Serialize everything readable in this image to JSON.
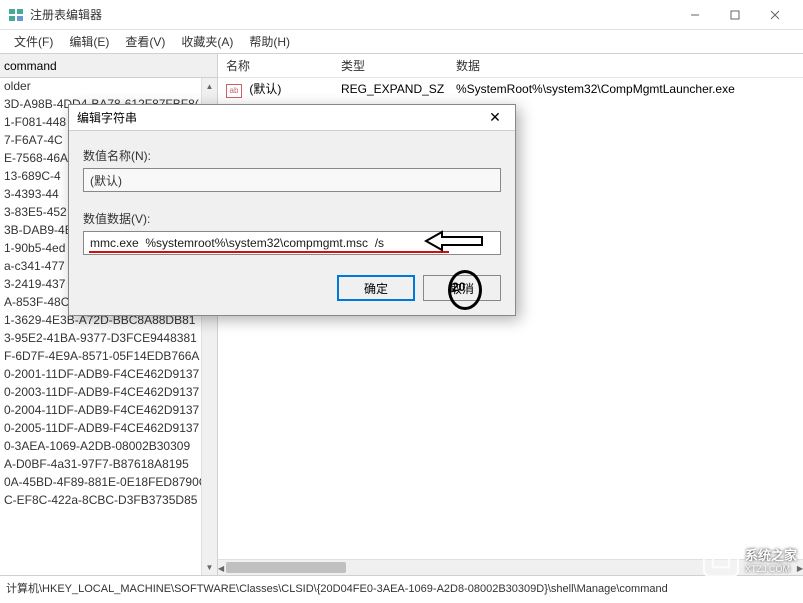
{
  "window": {
    "title": "注册表编辑器"
  },
  "menu": {
    "file": "文件(F)",
    "edit": "编辑(E)",
    "view": "查看(V)",
    "favorites": "收藏夹(A)",
    "help": "帮助(H)"
  },
  "tree": {
    "header": "command",
    "rows": [
      "older",
      "3D-A98B-4DD4-BA78-612F87FBF8(",
      "1-F081-448",
      "7-F6A7-4C",
      "E-7568-46A",
      "13-689C-4",
      "3-4393-44",
      "3-83E5-452",
      "3B-DAB9-4E",
      "1-90b5-4ed",
      "a-c341-477",
      "3-2419-437",
      "A-853F-48C4-8DC4-024E0D68A81",
      "1-3629-4E3B-A72D-BBC8A88DB81",
      "3-95E2-41BA-9377-D3FCE9448381",
      "F-6D7F-4E9A-8571-05F14EDB766A",
      "0-2001-11DF-ADB9-F4CE462D9137",
      "0-2003-11DF-ADB9-F4CE462D9137",
      "0-2004-11DF-ADB9-F4CE462D9137",
      "0-2005-11DF-ADB9-F4CE462D9137",
      "0-3AEA-1069-A2DB-08002B30309",
      "A-D0BF-4a31-97F7-B87618A8195",
      "0A-45BD-4F89-881E-0E18FED8790C",
      "C-EF8C-422a-8CBC-D3FB3735D85"
    ]
  },
  "list": {
    "cols": {
      "name": "名称",
      "type": "类型",
      "data": "数据"
    },
    "row": {
      "name": "(默认)",
      "type": "REG_EXPAND_SZ",
      "data": "%SystemRoot%\\system32\\CompMgmtLauncher.exe"
    }
  },
  "statusbar": {
    "path": "计算机\\HKEY_LOCAL_MACHINE\\SOFTWARE\\Classes\\CLSID\\{20D04FE0-3AEA-1069-A2D8-08002B30309D}\\shell\\Manage\\command"
  },
  "dialog": {
    "title": "编辑字符串",
    "name_label": "数值名称(N):",
    "name_value": "(默认)",
    "data_label": "数值数据(V):",
    "data_value": "mmc.exe  %systemroot%\\system32\\compmgmt.msc  /s",
    "ok": "确定",
    "cancel": "取消"
  },
  "annotation": {
    "circle_text": "20"
  },
  "watermark": {
    "text": "系统之家",
    "sub": "XTZJ.COM"
  }
}
